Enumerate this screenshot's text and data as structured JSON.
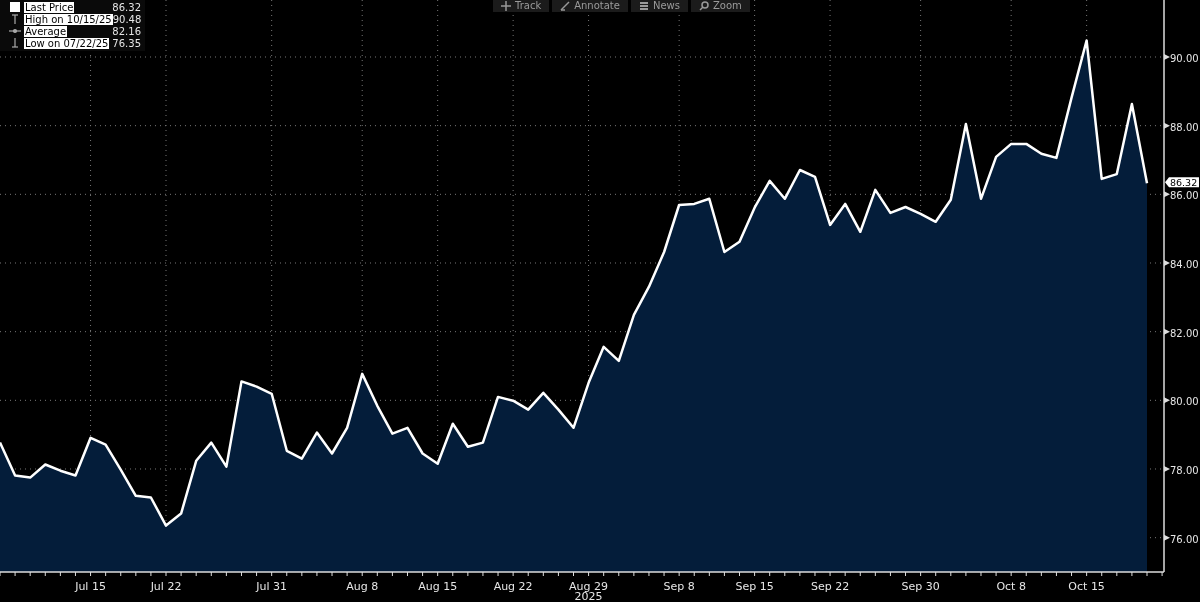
{
  "toolbar": [
    {
      "kind": "track",
      "label": "Track"
    },
    {
      "kind": "annotate",
      "label": "Annotate"
    },
    {
      "kind": "news",
      "label": "News"
    },
    {
      "kind": "zoom",
      "label": "Zoom"
    }
  ],
  "legend": [
    {
      "kind": "last",
      "value": "86.32"
    },
    {
      "kind": "high",
      "label": "High on 10/15/25",
      "value": "90.48"
    },
    {
      "kind": "average",
      "label": "Average",
      "value": "82.16"
    },
    {
      "kind": "low",
      "label": "Low on 07/22/25",
      "value": "76.35"
    }
  ],
  "chart": {
    "last_price_tag": "86.32",
    "year_label": "2025",
    "chart_data": {
      "type": "area",
      "grid": true,
      "categories": [
        null,
        null,
        null,
        null,
        null,
        null,
        "Jul 15",
        null,
        null,
        null,
        null,
        "Jul 22",
        null,
        null,
        null,
        null,
        null,
        null,
        "Jul 31",
        null,
        null,
        null,
        null,
        null,
        "Aug 8",
        null,
        null,
        null,
        null,
        "Aug 15",
        null,
        null,
        null,
        null,
        "Aug 22",
        null,
        null,
        null,
        null,
        "Aug 29",
        null,
        null,
        null,
        null,
        null,
        "Sep 8",
        null,
        null,
        null,
        null,
        "Sep 15",
        null,
        null,
        null,
        null,
        "Sep 22",
        null,
        null,
        null,
        null,
        null,
        "Sep 30",
        null,
        null,
        null,
        null,
        null,
        "Oct 8",
        null,
        null,
        null,
        null,
        "Oct 15",
        null,
        null,
        null,
        null
      ],
      "series": [
        {
          "name": "Last Price",
          "color": "#ffffff",
          "values": [
            78.77,
            77.81,
            77.75,
            78.13,
            77.95,
            77.81,
            78.91,
            78.71,
            77.98,
            77.22,
            77.17,
            76.35,
            76.7,
            78.24,
            78.77,
            78.07,
            80.55,
            80.4,
            80.19,
            78.53,
            78.3,
            79.06,
            78.45,
            79.2,
            80.77,
            79.84,
            79.03,
            79.2,
            78.45,
            78.15,
            79.32,
            78.65,
            78.77,
            80.1,
            79.99,
            79.73,
            80.22,
            79.73,
            79.2,
            80.51,
            81.56,
            81.15,
            82.49,
            83.31,
            84.32,
            85.69,
            85.72,
            85.87,
            84.32,
            84.62,
            85.61,
            86.39,
            85.87,
            86.71,
            86.51,
            85.11,
            85.72,
            84.91,
            86.13,
            85.46,
            85.63,
            85.43,
            85.2,
            85.84,
            88.05,
            85.87,
            87.09,
            87.47,
            87.47,
            87.18,
            87.06,
            88.81,
            90.48,
            86.45,
            86.59,
            88.63,
            86.32
          ]
        }
      ],
      "ylim": [
        75,
        91.66
      ],
      "yticks": [
        {
          "value": 76,
          "label": "76.00"
        },
        {
          "value": 78,
          "label": "78.00"
        },
        {
          "value": 80,
          "label": "80.00"
        },
        {
          "value": 82,
          "label": "82.00"
        },
        {
          "value": 84,
          "label": "84.00"
        },
        {
          "value": 86,
          "label": "86.00"
        },
        {
          "value": 88,
          "label": "88.00"
        },
        {
          "value": 90,
          "label": "90.00"
        }
      ]
    }
  }
}
